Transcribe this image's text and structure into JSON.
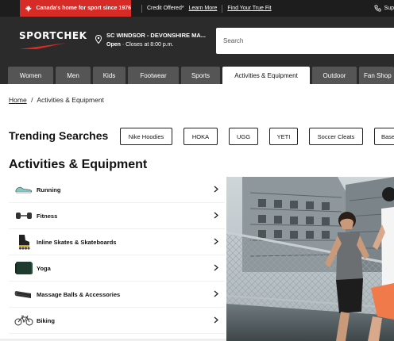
{
  "promo": {
    "red_text": "Canada's home for sport since 1976",
    "credit_text": "Credit Offered*",
    "learn_more": "Learn More",
    "true_fit": "Find Your True Fit",
    "support": "Sup"
  },
  "header": {
    "logo": "SPORTCHEK",
    "store_name": "SC WINDSOR - DEVONSHIRE MA...",
    "store_status": "Open",
    "store_hours": "· Closes at 8:00 p.m.",
    "search_placeholder": "Search"
  },
  "nav": {
    "tabs": [
      {
        "label": "Women"
      },
      {
        "label": "Men"
      },
      {
        "label": "Kids"
      },
      {
        "label": "Footwear"
      },
      {
        "label": "Sports"
      },
      {
        "label": "Activities & Equipment"
      },
      {
        "label": "Outdoor"
      },
      {
        "label": "Fan Shop"
      }
    ]
  },
  "breadcrumb": {
    "home": "Home",
    "separator": "/",
    "current": "Activities & Equipment"
  },
  "trending": {
    "title": "Trending Searches",
    "chips": [
      "Nike Hoodies",
      "HOKA",
      "UGG",
      "YETI",
      "Soccer Cleats",
      "Base"
    ]
  },
  "section": {
    "title": "Activities & Equipment",
    "categories": [
      {
        "label": "Running",
        "icon": "shoe-icon"
      },
      {
        "label": "Fitness",
        "icon": "dumbbell-icon"
      },
      {
        "label": "Inline Skates & Skateboards",
        "icon": "inline-skate-icon"
      },
      {
        "label": "Yoga",
        "icon": "yoga-mat-icon"
      },
      {
        "label": "Massage Balls & Accessories",
        "icon": "foam-roller-icon"
      },
      {
        "label": "Biking",
        "icon": "bicycle-icon"
      }
    ]
  },
  "colors": {
    "brand_red": "#d72b27",
    "header_dark": "#2b2b2b",
    "tab_gray": "#555555"
  }
}
